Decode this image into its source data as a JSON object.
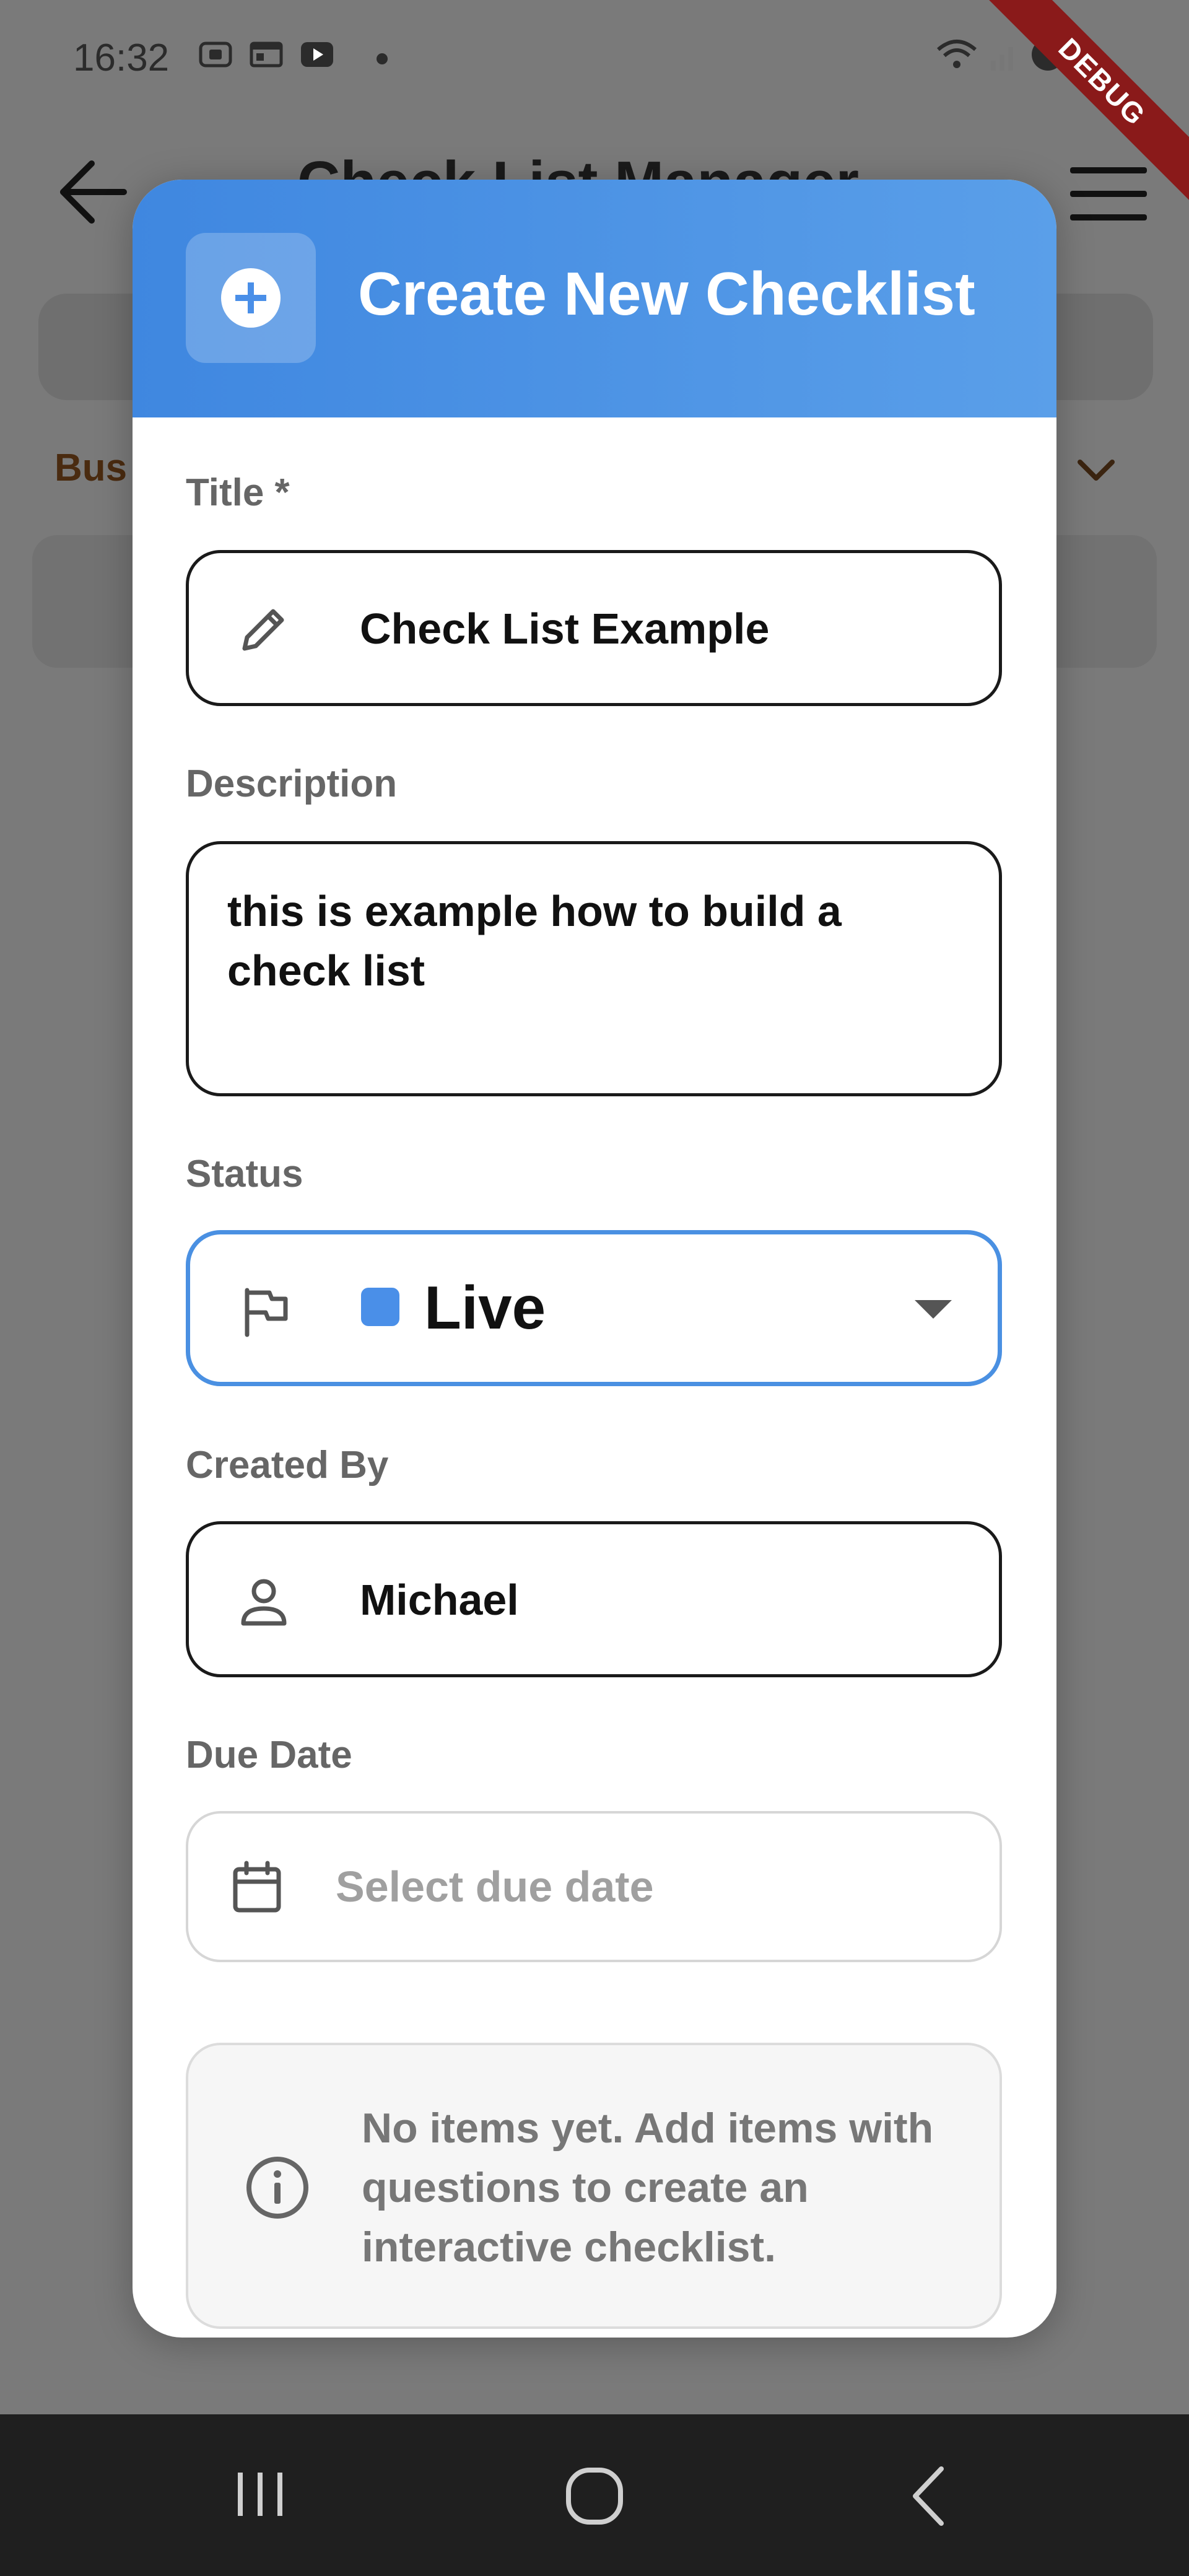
{
  "status_bar": {
    "time": "16:32"
  },
  "debug_banner": "DEBUG",
  "app_bar": {
    "title": "Check List Manager",
    "bg_filter_label": "Bus"
  },
  "modal": {
    "title": "Create New Checklist",
    "title_field": {
      "label": "Title *",
      "value": "Check List Example"
    },
    "description_field": {
      "label": "Description",
      "value": "this is example how to build a check list"
    },
    "status_field": {
      "label": "Status",
      "value": "Live",
      "swatch_color": "#4a8fe8"
    },
    "created_by_field": {
      "label": "Created By",
      "value": "Michael"
    },
    "due_date_field": {
      "label": "Due Date",
      "placeholder": "Select due date"
    },
    "info_message": "No items yet. Add items with questions to create an interactive checklist."
  },
  "colors": {
    "header_start": "#3f87e0",
    "header_end": "#5a9fe9",
    "accent": "#4a90e2",
    "scrim": "#7a7a7a"
  }
}
